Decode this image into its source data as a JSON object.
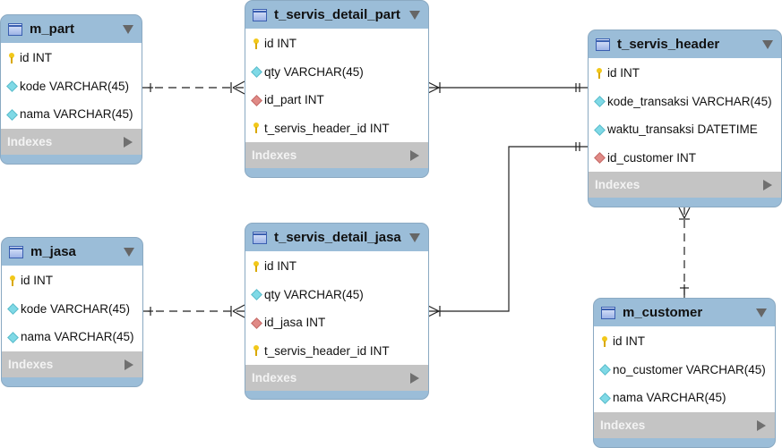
{
  "tables": {
    "m_part": {
      "name": "m_part",
      "columns": [
        {
          "icon": "key",
          "label": "id INT"
        },
        {
          "icon": "dia",
          "label": "kode VARCHAR(45)"
        },
        {
          "icon": "dia",
          "label": "nama VARCHAR(45)"
        }
      ],
      "indexes": "Indexes"
    },
    "t_servis_detail_part": {
      "name": "t_servis_detail_part",
      "columns": [
        {
          "icon": "key",
          "label": "id INT"
        },
        {
          "icon": "dia",
          "label": "qty VARCHAR(45)"
        },
        {
          "icon": "fk",
          "label": "id_part INT"
        },
        {
          "icon": "key",
          "label": "t_servis_header_id INT"
        }
      ],
      "indexes": "Indexes"
    },
    "t_servis_header": {
      "name": "t_servis_header",
      "columns": [
        {
          "icon": "key",
          "label": "id INT"
        },
        {
          "icon": "dia",
          "label": "kode_transaksi VARCHAR(45)"
        },
        {
          "icon": "dia",
          "label": "waktu_transaksi DATETIME"
        },
        {
          "icon": "fk",
          "label": "id_customer INT"
        }
      ],
      "indexes": "Indexes"
    },
    "m_jasa": {
      "name": "m_jasa",
      "columns": [
        {
          "icon": "key",
          "label": "id INT"
        },
        {
          "icon": "dia",
          "label": "kode VARCHAR(45)"
        },
        {
          "icon": "dia",
          "label": "nama VARCHAR(45)"
        }
      ],
      "indexes": "Indexes"
    },
    "t_servis_detail_jasa": {
      "name": "t_servis_detail_jasa",
      "columns": [
        {
          "icon": "key",
          "label": "id INT"
        },
        {
          "icon": "dia",
          "label": "qty VARCHAR(45)"
        },
        {
          "icon": "fk",
          "label": "id_jasa INT"
        },
        {
          "icon": "key",
          "label": "t_servis_header_id INT"
        }
      ],
      "indexes": "Indexes"
    },
    "m_customer": {
      "name": "m_customer",
      "columns": [
        {
          "icon": "key",
          "label": "id INT"
        },
        {
          "icon": "dia",
          "label": "no_customer VARCHAR(45)"
        },
        {
          "icon": "dia",
          "label": "nama VARCHAR(45)"
        }
      ],
      "indexes": "Indexes"
    }
  },
  "relationships": [
    {
      "from": "m_part",
      "to": "t_servis_detail_part",
      "style": "dashed",
      "cardinality": "one-to-many"
    },
    {
      "from": "t_servis_header",
      "to": "t_servis_detail_part",
      "style": "solid",
      "cardinality": "one-to-many"
    },
    {
      "from": "t_servis_header",
      "to": "t_servis_detail_jasa",
      "style": "solid",
      "cardinality": "one-to-many"
    },
    {
      "from": "m_jasa",
      "to": "t_servis_detail_jasa",
      "style": "dashed",
      "cardinality": "one-to-many"
    },
    {
      "from": "m_customer",
      "to": "t_servis_header",
      "style": "dashed",
      "cardinality": "one-to-many"
    }
  ],
  "colors": {
    "header": "#9bbdd8",
    "indexes": "#c4c4c4",
    "key": "#f2c81a",
    "column": "#7fd9e6",
    "foreign_key": "#e08a86"
  }
}
